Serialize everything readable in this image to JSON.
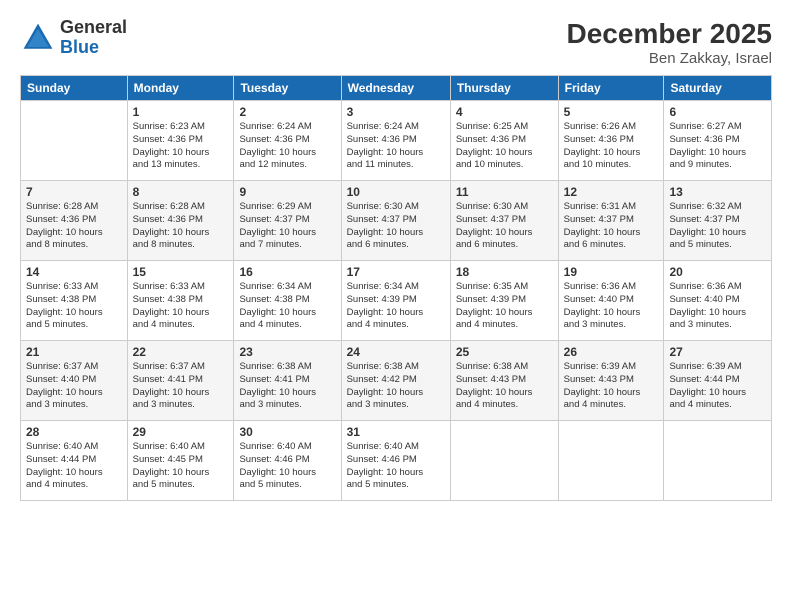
{
  "header": {
    "logo_general": "General",
    "logo_blue": "Blue",
    "month_title": "December 2025",
    "subtitle": "Ben Zakkay, Israel"
  },
  "columns": [
    "Sunday",
    "Monday",
    "Tuesday",
    "Wednesday",
    "Thursday",
    "Friday",
    "Saturday"
  ],
  "weeks": [
    [
      {
        "date": "",
        "info": ""
      },
      {
        "date": "1",
        "info": "Sunrise: 6:23 AM\nSunset: 4:36 PM\nDaylight: 10 hours\nand 13 minutes."
      },
      {
        "date": "2",
        "info": "Sunrise: 6:24 AM\nSunset: 4:36 PM\nDaylight: 10 hours\nand 12 minutes."
      },
      {
        "date": "3",
        "info": "Sunrise: 6:24 AM\nSunset: 4:36 PM\nDaylight: 10 hours\nand 11 minutes."
      },
      {
        "date": "4",
        "info": "Sunrise: 6:25 AM\nSunset: 4:36 PM\nDaylight: 10 hours\nand 10 minutes."
      },
      {
        "date": "5",
        "info": "Sunrise: 6:26 AM\nSunset: 4:36 PM\nDaylight: 10 hours\nand 10 minutes."
      },
      {
        "date": "6",
        "info": "Sunrise: 6:27 AM\nSunset: 4:36 PM\nDaylight: 10 hours\nand 9 minutes."
      }
    ],
    [
      {
        "date": "7",
        "info": "Sunrise: 6:28 AM\nSunset: 4:36 PM\nDaylight: 10 hours\nand 8 minutes."
      },
      {
        "date": "8",
        "info": "Sunrise: 6:28 AM\nSunset: 4:36 PM\nDaylight: 10 hours\nand 8 minutes."
      },
      {
        "date": "9",
        "info": "Sunrise: 6:29 AM\nSunset: 4:37 PM\nDaylight: 10 hours\nand 7 minutes."
      },
      {
        "date": "10",
        "info": "Sunrise: 6:30 AM\nSunset: 4:37 PM\nDaylight: 10 hours\nand 6 minutes."
      },
      {
        "date": "11",
        "info": "Sunrise: 6:30 AM\nSunset: 4:37 PM\nDaylight: 10 hours\nand 6 minutes."
      },
      {
        "date": "12",
        "info": "Sunrise: 6:31 AM\nSunset: 4:37 PM\nDaylight: 10 hours\nand 6 minutes."
      },
      {
        "date": "13",
        "info": "Sunrise: 6:32 AM\nSunset: 4:37 PM\nDaylight: 10 hours\nand 5 minutes."
      }
    ],
    [
      {
        "date": "14",
        "info": "Sunrise: 6:33 AM\nSunset: 4:38 PM\nDaylight: 10 hours\nand 5 minutes."
      },
      {
        "date": "15",
        "info": "Sunrise: 6:33 AM\nSunset: 4:38 PM\nDaylight: 10 hours\nand 4 minutes."
      },
      {
        "date": "16",
        "info": "Sunrise: 6:34 AM\nSunset: 4:38 PM\nDaylight: 10 hours\nand 4 minutes."
      },
      {
        "date": "17",
        "info": "Sunrise: 6:34 AM\nSunset: 4:39 PM\nDaylight: 10 hours\nand 4 minutes."
      },
      {
        "date": "18",
        "info": "Sunrise: 6:35 AM\nSunset: 4:39 PM\nDaylight: 10 hours\nand 4 minutes."
      },
      {
        "date": "19",
        "info": "Sunrise: 6:36 AM\nSunset: 4:40 PM\nDaylight: 10 hours\nand 3 minutes."
      },
      {
        "date": "20",
        "info": "Sunrise: 6:36 AM\nSunset: 4:40 PM\nDaylight: 10 hours\nand 3 minutes."
      }
    ],
    [
      {
        "date": "21",
        "info": "Sunrise: 6:37 AM\nSunset: 4:40 PM\nDaylight: 10 hours\nand 3 minutes."
      },
      {
        "date": "22",
        "info": "Sunrise: 6:37 AM\nSunset: 4:41 PM\nDaylight: 10 hours\nand 3 minutes."
      },
      {
        "date": "23",
        "info": "Sunrise: 6:38 AM\nSunset: 4:41 PM\nDaylight: 10 hours\nand 3 minutes."
      },
      {
        "date": "24",
        "info": "Sunrise: 6:38 AM\nSunset: 4:42 PM\nDaylight: 10 hours\nand 3 minutes."
      },
      {
        "date": "25",
        "info": "Sunrise: 6:38 AM\nSunset: 4:43 PM\nDaylight: 10 hours\nand 4 minutes."
      },
      {
        "date": "26",
        "info": "Sunrise: 6:39 AM\nSunset: 4:43 PM\nDaylight: 10 hours\nand 4 minutes."
      },
      {
        "date": "27",
        "info": "Sunrise: 6:39 AM\nSunset: 4:44 PM\nDaylight: 10 hours\nand 4 minutes."
      }
    ],
    [
      {
        "date": "28",
        "info": "Sunrise: 6:40 AM\nSunset: 4:44 PM\nDaylight: 10 hours\nand 4 minutes."
      },
      {
        "date": "29",
        "info": "Sunrise: 6:40 AM\nSunset: 4:45 PM\nDaylight: 10 hours\nand 5 minutes."
      },
      {
        "date": "30",
        "info": "Sunrise: 6:40 AM\nSunset: 4:46 PM\nDaylight: 10 hours\nand 5 minutes."
      },
      {
        "date": "31",
        "info": "Sunrise: 6:40 AM\nSunset: 4:46 PM\nDaylight: 10 hours\nand 5 minutes."
      },
      {
        "date": "",
        "info": ""
      },
      {
        "date": "",
        "info": ""
      },
      {
        "date": "",
        "info": ""
      }
    ]
  ]
}
